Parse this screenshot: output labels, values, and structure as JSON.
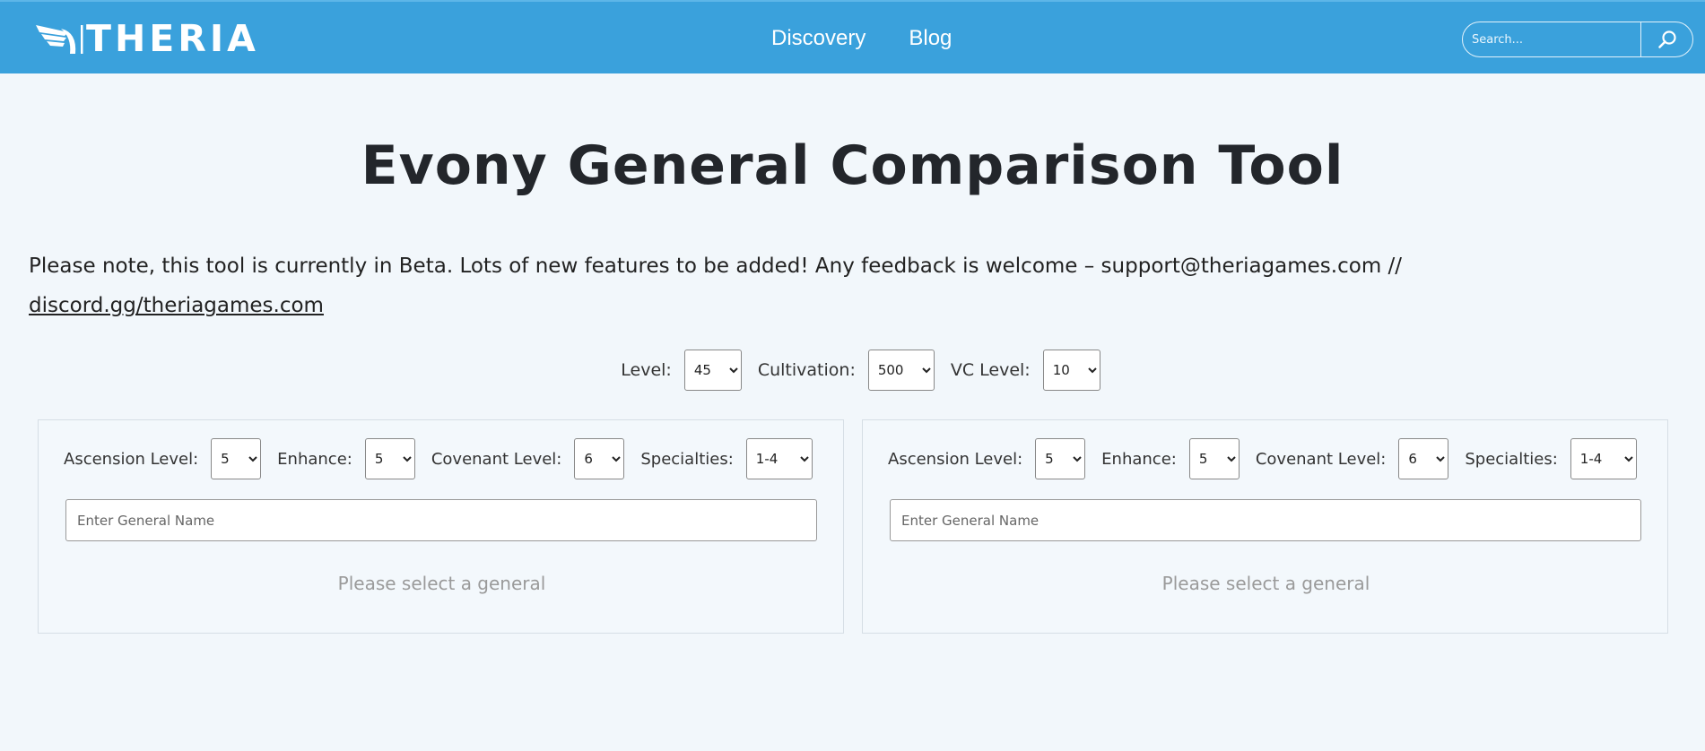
{
  "header": {
    "logo_text": "THERIA",
    "nav": [
      {
        "label": "Discovery"
      },
      {
        "label": "Blog"
      }
    ],
    "search": {
      "placeholder": "Search..."
    }
  },
  "main": {
    "title": "Evony General Comparison Tool",
    "note_text": "Please note, this tool is currently in Beta. Lots of new features to be added! Any feedback is welcome – support@theriagames.com //",
    "note_link": "discord.gg/theriagames.com",
    "global_controls": {
      "level_label": "Level:",
      "level_value": "45",
      "cultivation_label": "Cultivation:",
      "cultivation_value": "500",
      "vc_label": "VC Level:",
      "vc_value": "10"
    },
    "panels": [
      {
        "ascension_label": "Ascension Level:",
        "ascension_value": "5",
        "enhance_label": "Enhance:",
        "enhance_value": "5",
        "covenant_label": "Covenant Level:",
        "covenant_value": "6",
        "specialties_label": "Specialties:",
        "specialties_value": "1-4",
        "name_placeholder": "Enter General Name",
        "empty_text": "Please select a general"
      },
      {
        "ascension_label": "Ascension Level:",
        "ascension_value": "5",
        "enhance_label": "Enhance:",
        "enhance_value": "5",
        "covenant_label": "Covenant Level:",
        "covenant_value": "6",
        "specialties_label": "Specialties:",
        "specialties_value": "1-4",
        "name_placeholder": "Enter General Name",
        "empty_text": "Please select a general"
      }
    ]
  },
  "colors": {
    "header_bg": "#3aa1dc",
    "page_bg": "#f2f7fb",
    "panel_bg": "#f3f8fc"
  }
}
